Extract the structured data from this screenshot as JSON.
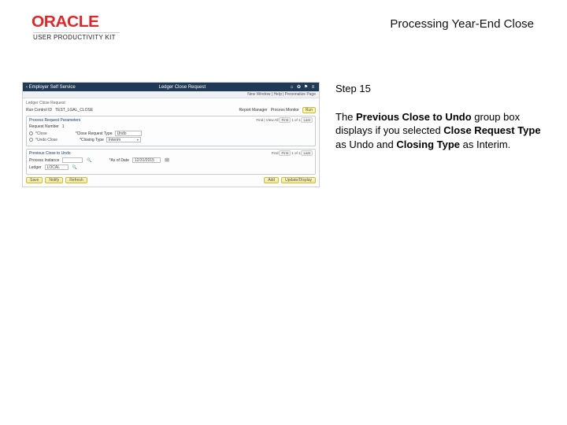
{
  "header": {
    "brand": "ORACLE",
    "product": "USER PRODUCTIVITY KIT",
    "page_title": "Processing Year-End Close"
  },
  "right": {
    "step_label": "Step 15",
    "desc_parts": {
      "t1": "The ",
      "b1": "Previous Close to Undo",
      "t2": " group box displays if you selected ",
      "b2": "Close Request Type",
      "t3": " as  Undo and ",
      "b3": "Closing Type",
      "t4": " as Interim."
    }
  },
  "shot": {
    "topbar": {
      "back_label": "‹ Employer Self Service",
      "center_title": "Ledger Close Request",
      "icons": [
        "home-icon",
        "gear-icon",
        "flag-icon",
        "menu-icon"
      ]
    },
    "subbar_text": "New Window | Help | Personalize Page",
    "tabs_text": "Ledger   Close Request",
    "meta": {
      "run_ctl_label": "Run Control ID",
      "run_ctl_value": "TEST_LGAL_CLOSE",
      "report_mgr": "Report Manager",
      "proc_mon": "Process Monitor",
      "run_btn": "Run"
    },
    "group1": {
      "title": "Process Request Parameters",
      "request_no_label": "Request Number",
      "request_no_value": "1",
      "opt_close": "*Close",
      "opt_undo": "*Undo Close",
      "close_req_type_label": "*Close Request Type",
      "close_req_type_value": "Undo",
      "closing_type_label": "*Closing Type",
      "closing_type_value": "Interim",
      "nav": {
        "find": "Find | View All",
        "first": "First",
        "range": "1 of 1",
        "last": "Last"
      }
    },
    "group2": {
      "title": "Previous Close to Undo",
      "proc_instance_label": "Process Instance",
      "ledger_label": "Ledger",
      "ledger_value": "LOCAL",
      "as_of_label": "*As of Date",
      "as_of_value": "12/31/2015",
      "nav": {
        "find": "Find",
        "first": "First",
        "range": "1 of 1",
        "last": "Last"
      }
    },
    "footer": {
      "save": "Save",
      "notify": "Notify",
      "refresh": "Refresh",
      "add": "Add",
      "update": "Update/Display"
    }
  }
}
